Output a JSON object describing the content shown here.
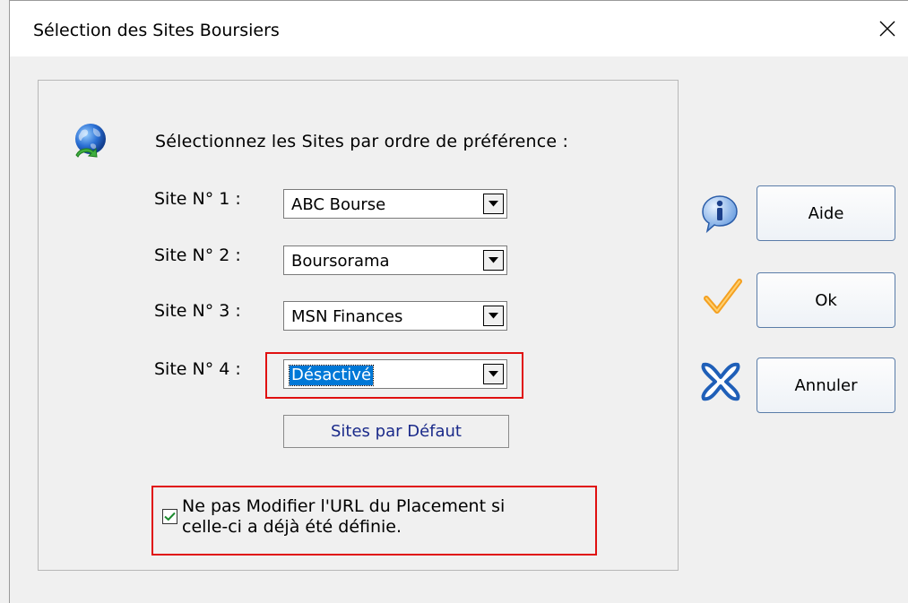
{
  "window": {
    "title": "Sélection des Sites Boursiers"
  },
  "icons": {
    "close": "close-icon",
    "globe": "globe-icon",
    "info": "info-icon",
    "ok": "checkmark-icon",
    "cancel": "cross-icon",
    "dropdown": "chevron-down-icon"
  },
  "main": {
    "intro": "Sélectionnez les Sites par ordre de préférence :",
    "sites": [
      {
        "label": "Site N° 1 :",
        "value": "ABC Bourse",
        "selected": false
      },
      {
        "label": "Site N° 2 :",
        "value": "Boursorama",
        "selected": false
      },
      {
        "label": "Site N° 3 :",
        "value": "MSN Finances",
        "selected": false
      },
      {
        "label": "Site N° 4 :",
        "value": "Désactivé",
        "selected": true
      }
    ],
    "default_button": "Sites par Défaut",
    "checkbox": {
      "checked": true,
      "label_line1": "Ne pas Modifier l'URL du Placement si",
      "label_line2": "celle-ci a déjà été définie."
    }
  },
  "buttons": {
    "help": "Aide",
    "ok": "Ok",
    "cancel": "Annuler"
  },
  "colors": {
    "highlight": "#e01010",
    "selection": "#0078d7",
    "button_border": "#5a7ca8",
    "link_text": "#1a2a8a"
  }
}
